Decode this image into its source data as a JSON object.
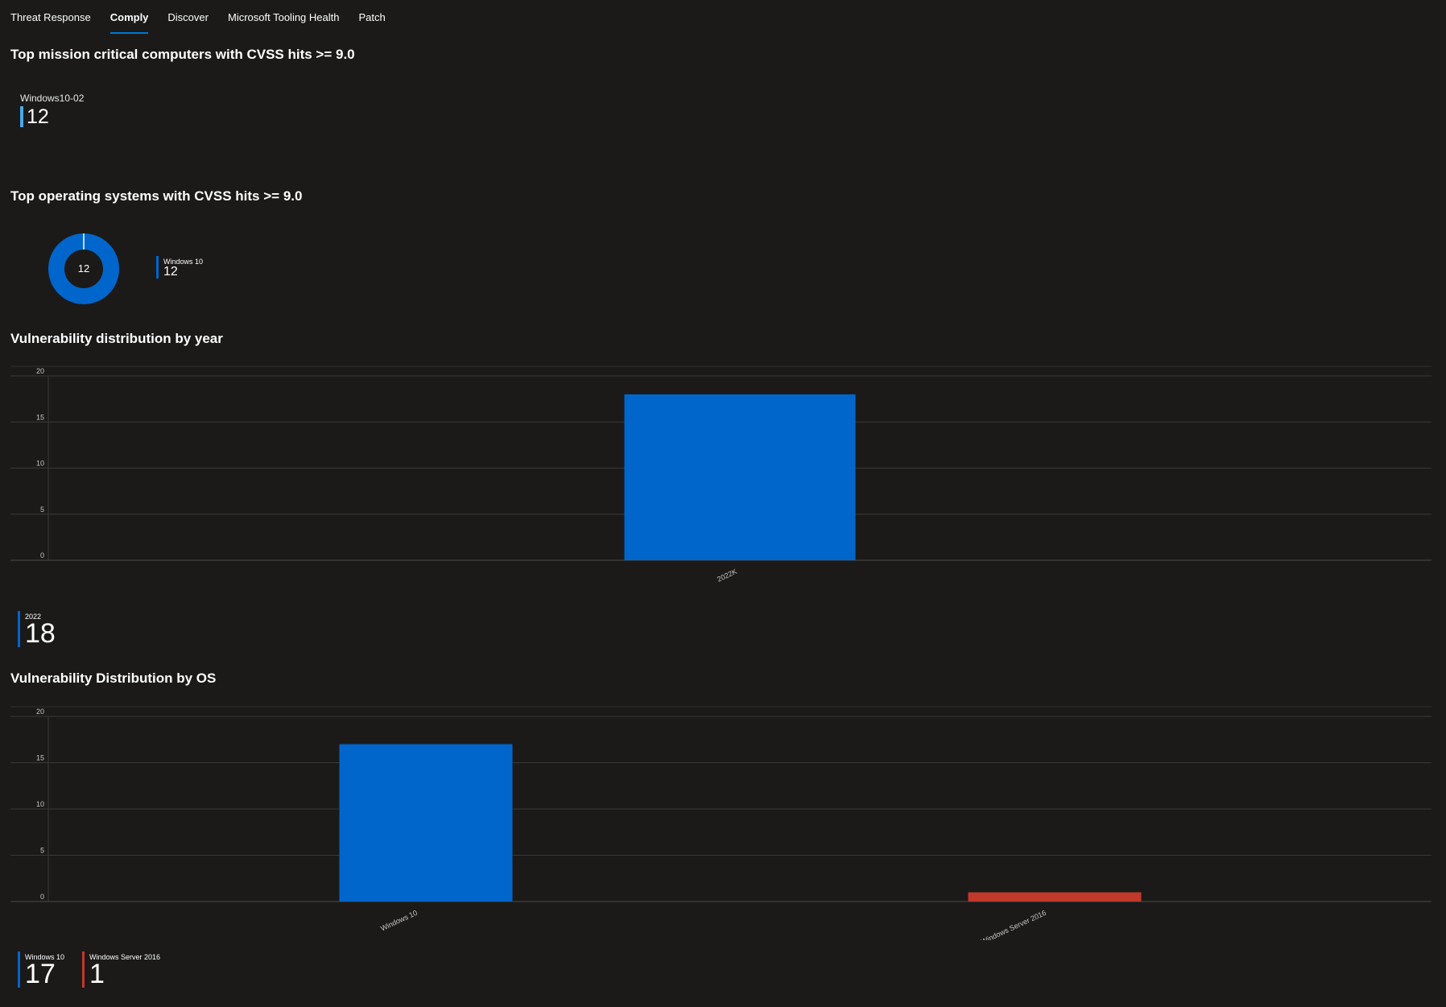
{
  "tabs": [
    {
      "label": "Threat Response",
      "active": false
    },
    {
      "label": "Comply",
      "active": true
    },
    {
      "label": "Discover",
      "active": false
    },
    {
      "label": "Microsoft Tooling Health",
      "active": false
    },
    {
      "label": "Patch",
      "active": false
    }
  ],
  "sections": {
    "critical_computers": {
      "title": "Top mission critical computers with CVSS hits >= 9.0",
      "kpi": {
        "name": "Windows10-02",
        "value": "12",
        "color": "#4aa8e8"
      }
    },
    "top_os": {
      "title": "Top operating systems with CVSS hits >= 9.0",
      "donut_center": "12",
      "legend": [
        {
          "name": "Windows 10",
          "value": "12",
          "color": "#0066cc"
        }
      ]
    },
    "by_year": {
      "title": "Vulnerability distribution by year",
      "legend": [
        {
          "name": "2022",
          "value": "18",
          "color": "#0066cc"
        }
      ]
    },
    "by_os": {
      "title": "Vulnerability Distribution by OS",
      "legend": [
        {
          "name": "Windows 10",
          "value": "17",
          "color": "#0066cc"
        },
        {
          "name": "Windows Server 2016",
          "value": "1",
          "color": "#c0392b"
        }
      ]
    }
  },
  "chart_data": [
    {
      "type": "pie",
      "title": "Top operating systems with CVSS hits >= 9.0",
      "categories": [
        "Windows 10"
      ],
      "values": [
        12
      ],
      "colors": [
        "#0066cc"
      ],
      "center_label": "12"
    },
    {
      "type": "bar",
      "title": "Vulnerability distribution by year",
      "categories": [
        "2022K"
      ],
      "values": [
        18
      ],
      "colors": [
        "#0066cc"
      ],
      "ylim": [
        0,
        20
      ],
      "yticks": [
        0,
        5,
        10,
        15,
        20
      ],
      "grid": true
    },
    {
      "type": "bar",
      "title": "Vulnerability Distribution by OS",
      "categories": [
        "Windows 10",
        "Windows Server 2016"
      ],
      "values": [
        17,
        1
      ],
      "colors": [
        "#0066cc",
        "#c0392b"
      ],
      "ylim": [
        0,
        20
      ],
      "yticks": [
        0,
        5,
        10,
        15,
        20
      ],
      "grid": true
    }
  ]
}
